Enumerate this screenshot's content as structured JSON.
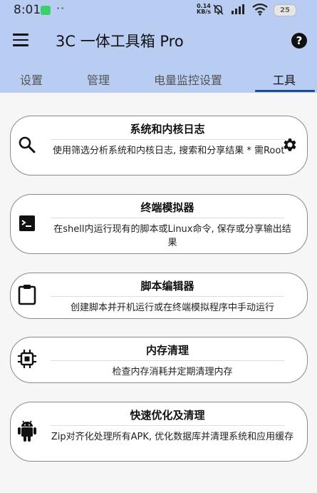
{
  "status_bar": {
    "time": "8:01",
    "dots": "··",
    "net_speed_value": "0.14",
    "net_speed_unit": "KB/s",
    "battery": "25"
  },
  "app_bar": {
    "title": "3C 一体工具箱 Pro"
  },
  "tabs": [
    {
      "label": "设置",
      "active": false
    },
    {
      "label": "管理",
      "active": false
    },
    {
      "label": "电量监控设置",
      "active": false
    },
    {
      "label": "工具",
      "active": true
    }
  ],
  "cards": [
    {
      "title": "系统和内核日志",
      "description": "使用筛选分析系统和内核日志, 搜索和分享结果 * 需Root *",
      "icon": "search-icon",
      "right_icon": "gear-icon"
    },
    {
      "title": "终端模拟器",
      "description": "在shell内运行现有的脚本或Linux命令, 保存或分享输出结果",
      "icon": "terminal-icon"
    },
    {
      "title": "脚本编辑器",
      "description": "创建脚本并开机运行或在终端模拟程序中手动运行",
      "icon": "clipboard-icon"
    },
    {
      "title": "内存清理",
      "description": "检查内存消耗并定期清理内存",
      "icon": "memory-chip-icon"
    },
    {
      "title": "快速优化及清理",
      "description": "Zip对齐化处理所有APK, 优化数据库并清理系统和应用缓存",
      "icon": "android-icon"
    }
  ],
  "colors": {
    "app_bar_bg": "#b9cdf3",
    "tab_indicator": "#1b4e8f",
    "page_bg": "#f6f6f6"
  }
}
